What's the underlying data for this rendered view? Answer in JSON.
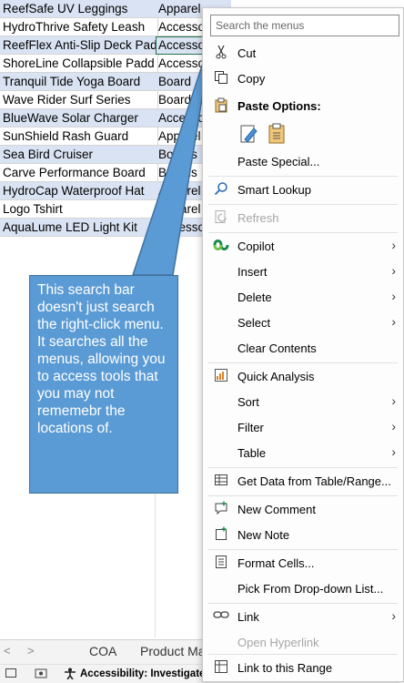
{
  "sheet": {
    "rows": [
      {
        "name": "ReefSafe UV Leggings",
        "category": "Apparel",
        "hl": true
      },
      {
        "name": "HydroThrive Safety Leash",
        "category": "Accesso",
        "hl": false
      },
      {
        "name": "ReefFlex Anti-Slip Deck Pad",
        "category": "Accesso",
        "hl": true
      },
      {
        "name": "ShoreLine Collapsible Padd",
        "category": "Accesso",
        "hl": false
      },
      {
        "name": "Tranquil Tide Yoga Board",
        "category": "Board",
        "hl": true
      },
      {
        "name": "Wave Rider Surf Series",
        "category": "Board",
        "hl": false
      },
      {
        "name": "BlueWave Solar Charger",
        "category": "Accesso",
        "hl": true
      },
      {
        "name": "SunShield Rash Guard",
        "category": "Apparel",
        "hl": false
      },
      {
        "name": "Sea Bird Cruiser",
        "category": "Boards",
        "hl": true
      },
      {
        "name": "Carve Performance Board",
        "category": "Boards",
        "hl": false
      },
      {
        "name": "HydroCap Waterproof Hat",
        "category": "Apparel",
        "hl": true
      },
      {
        "name": "Logo Tshirt",
        "category": "Apparel",
        "hl": false
      },
      {
        "name": "AquaLume LED Light Kit",
        "category": "Accesso",
        "hl": true
      }
    ]
  },
  "tabs": {
    "nav_prev": "<",
    "nav_next": ">",
    "items": [
      "COA",
      "Product Ma"
    ]
  },
  "status": {
    "accessibility": "Accessibility: Investigate"
  },
  "callout": {
    "text": "This search bar doesn't just search the right-click menu. It searches all the menus, allowing you to access tools that you may not rememebr the locations of."
  },
  "menu": {
    "search_placeholder": "Search the menus",
    "items": {
      "cut": "Cut",
      "copy": "Copy",
      "paste_options": "Paste Options:",
      "paste_special": "Paste Special...",
      "smart_lookup": "Smart Lookup",
      "refresh": "Refresh",
      "copilot": "Copilot",
      "insert": "Insert",
      "delete": "Delete",
      "select": "Select",
      "clear_contents": "Clear Contents",
      "quick_analysis": "Quick Analysis",
      "sort": "Sort",
      "filter": "Filter",
      "table": "Table",
      "get_data": "Get Data from Table/Range...",
      "new_comment": "New Comment",
      "new_note": "New Note",
      "format_cells": "Format Cells...",
      "pick_dropdown": "Pick From Drop-down List...",
      "link": "Link",
      "open_hyperlink": "Open Hyperlink",
      "link_to_range": "Link to this Range"
    },
    "submenu_arrow": "›"
  }
}
